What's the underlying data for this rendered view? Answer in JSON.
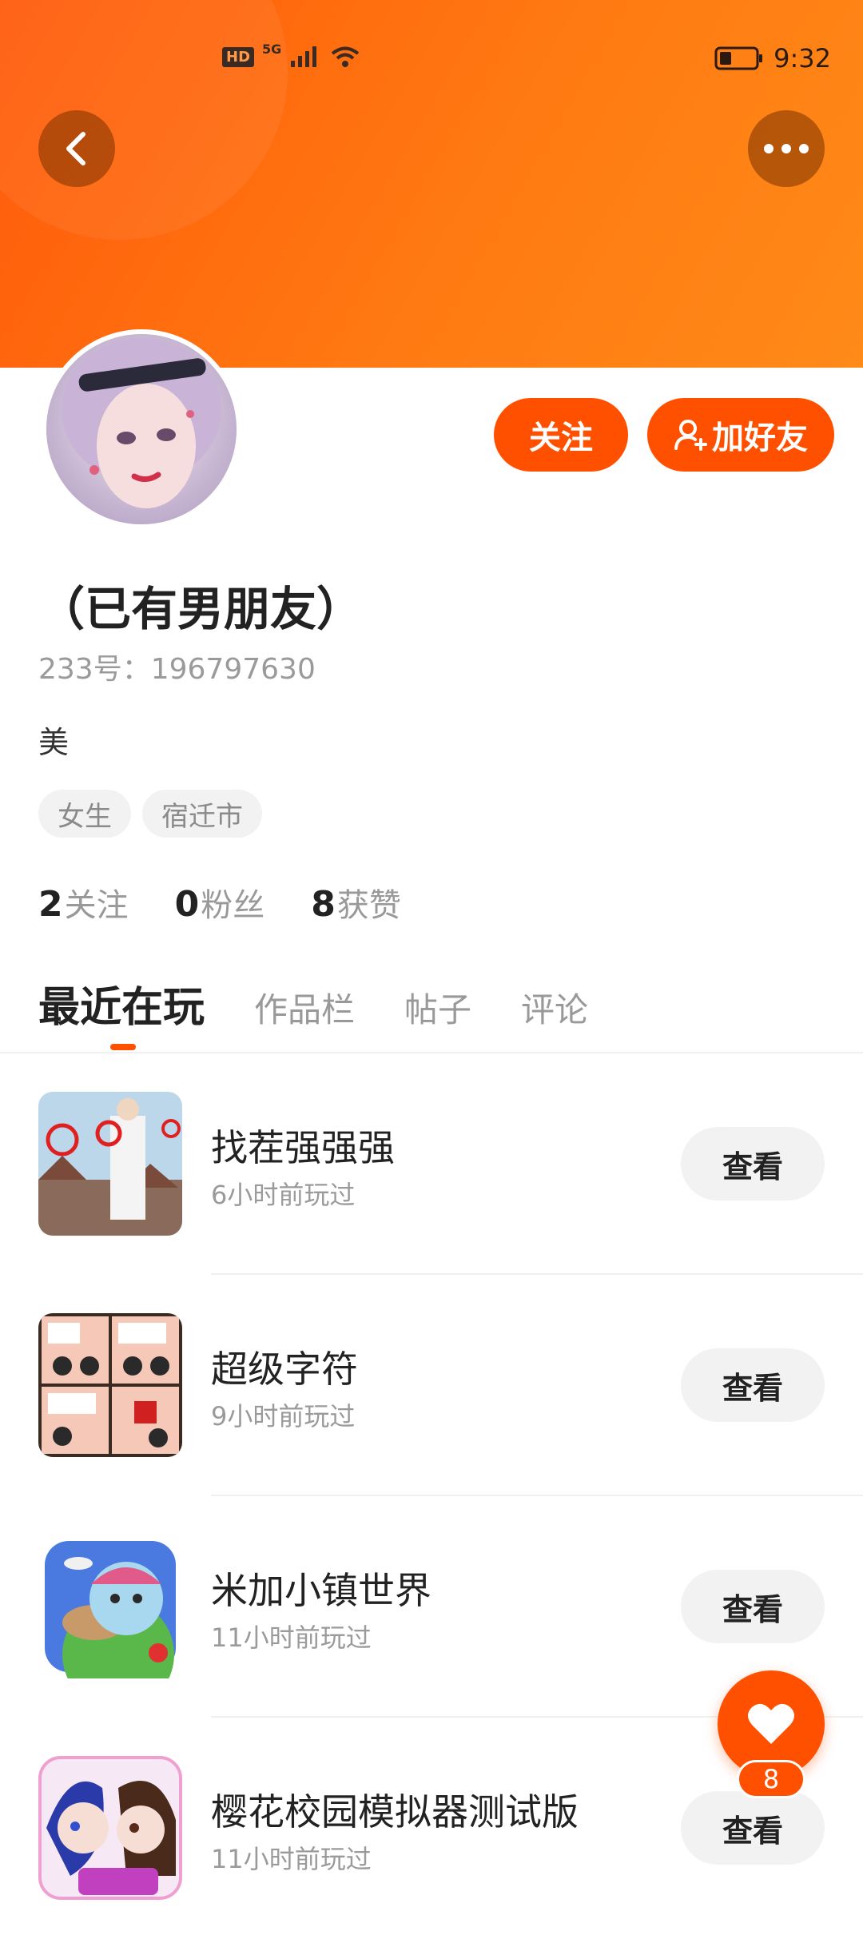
{
  "status_bar": {
    "network_badge": "HD",
    "network_type": "5G",
    "time": "9:32"
  },
  "profile": {
    "nickname": "（已有男朋友）",
    "user_id": "233号：196797630",
    "bio": "美",
    "tags": [
      "女生",
      "宿迁市"
    ],
    "follow_label": "关注",
    "add_friend_label": "加好友"
  },
  "stats": [
    {
      "value": "2",
      "label": "关注"
    },
    {
      "value": "0",
      "label": "粉丝"
    },
    {
      "value": "8",
      "label": "获赞"
    }
  ],
  "tabs": [
    {
      "label": "最近在玩",
      "active": true
    },
    {
      "label": "作品栏"
    },
    {
      "label": "帖子"
    },
    {
      "label": "评论"
    }
  ],
  "games": [
    {
      "name": "找茬强强强",
      "played": "6小时前玩过",
      "action": "查看"
    },
    {
      "name": "超级字符",
      "played": "9小时前玩过",
      "action": "查看"
    },
    {
      "name": "米加小镇世界",
      "played": "11小时前玩过",
      "action": "查看"
    },
    {
      "name": "樱花校园模拟器测试版",
      "played": "11小时前玩过",
      "action": "查看"
    }
  ],
  "like_fab": {
    "count": "8"
  },
  "colors": {
    "accent": "#ff5000",
    "header_start": "#ff5a0a",
    "header_end": "#ff8a18"
  }
}
